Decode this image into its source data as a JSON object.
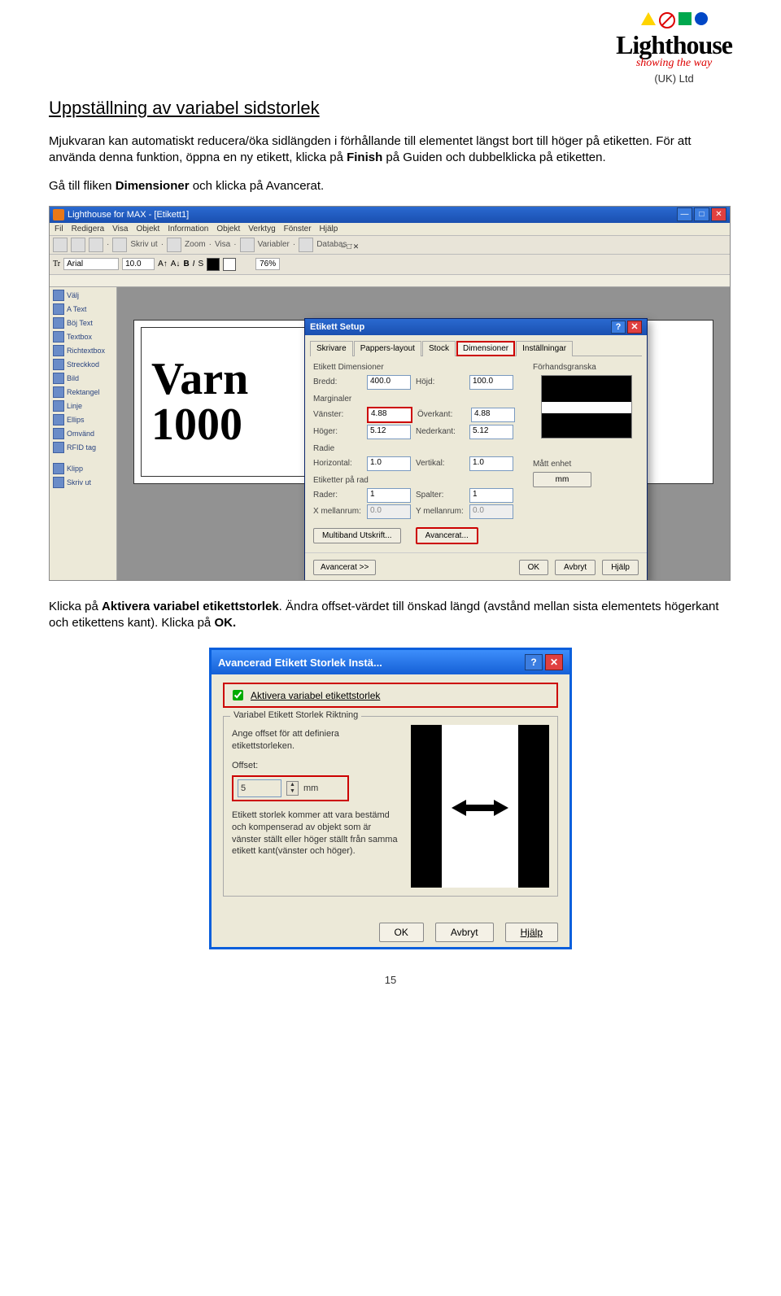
{
  "logo": {
    "brand": "Lighthouse",
    "tagline": "showing the way",
    "uk": "(UK) Ltd"
  },
  "title": "Uppställning av variabel sidstorlek",
  "para1_a": "Mjukvaran kan automatiskt reducera/öka sidlängden i förhållande till elementet längst bort till höger på etiketten. För att använda denna funktion, öppna en ny etikett, klicka på ",
  "para1_b": "Finish",
  "para1_c": " på Guiden och dubbelklicka på etiketten.",
  "para2_a": "Gå till fliken ",
  "para2_b": "Dimensioner",
  "para2_c": " och klicka på Avancerat.",
  "para3_a": "Klicka på ",
  "para3_b": "Aktivera variabel etikettstorlek",
  "para3_c": ". Ändra offset-värdet till önskad längd (avstånd mellan sista elementets högerkant och etikettens kant).  Klicka på ",
  "para3_d": "OK.",
  "app": {
    "title": "Lighthouse for MAX - [Etikett1]",
    "menu": [
      "Fil",
      "Redigera",
      "Visa",
      "Objekt",
      "Information",
      "Objekt",
      "Verktyg",
      "Fönster",
      "Hjälp"
    ],
    "tbwords": {
      "skriv": "Skriv ut",
      "zoom": "Zoom",
      "visa": "Visa",
      "var": "Variabler",
      "db": "Databas"
    },
    "font": "Arial",
    "fontsize": "10.0",
    "pct": "76%",
    "tools": [
      "Välj",
      "A Text",
      "Böj Text",
      "Textbox",
      "Richtextbox",
      "Streckkod",
      "Bild",
      "Rektangel",
      "Linje",
      "Ellips",
      "Omvänd",
      "RFID tag",
      "Klipp",
      "Skriv ut"
    ],
    "labelText1": "Varn",
    "labelText2": "1000"
  },
  "dialog": {
    "title": "Etikett Setup",
    "tabs": [
      "Skrivare",
      "Pappers-layout",
      "Stock",
      "Dimensioner",
      "Inställningar"
    ],
    "grpDim": "Etikett Dimensioner",
    "bredd": "Bredd:",
    "breddv": "400.0",
    "hojd": "Höjd:",
    "hojdv": "100.0",
    "grpMar": "Marginaler",
    "vanster": "Vänster:",
    "vansterv": "4.88",
    "overkant": "Överkant:",
    "overkantv": "4.88",
    "hoger": "Höger:",
    "hogerv": "5.12",
    "nederkant": "Nederkant:",
    "nederkantv": "5.12",
    "grpRad": "Radie",
    "horiz": "Horizontal:",
    "horizv": "1.0",
    "vert": "Vertikal:",
    "vertv": "1.0",
    "grpEt": "Etiketter på rad",
    "rader": "Rader:",
    "raderv": "1",
    "spalter": "Spalter:",
    "spalterv": "1",
    "xm": "X mellanrum:",
    "xmv": "0.0",
    "ym": "Y mellanrum:",
    "ymv": "0.0",
    "grpPrev": "Förhandsgranska",
    "grpMat": "Mått enhet",
    "mm": "mm",
    "multi": "Multiband Utskrift...",
    "adv": "Avancerat...",
    "expand": "Avancerat >>",
    "ok": "OK",
    "avbryt": "Avbryt",
    "hjalp": "Hjälp"
  },
  "advdlg": {
    "title": "Avancerad Etikett Storlek Instä...",
    "chk": "Aktivera variabel etikettstorlek",
    "legend": "Variabel Etikett Storlek Riktning",
    "desc": "Ange offset för att definiera etikettstorleken.",
    "offsetL": "Offset:",
    "offsetV": "5",
    "mm": "mm",
    "note": "Etikett storlek kommer att vara bestämd och kompenserad av objekt som är vänster ställt eller höger ställt från samma etikett kant(vänster och höger).",
    "ok": "OK",
    "avbryt": "Avbryt",
    "hjalp": "Hjälp"
  },
  "pagenum": "15"
}
